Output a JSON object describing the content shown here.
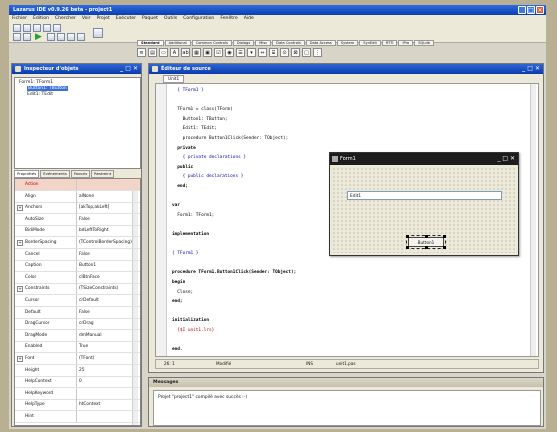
{
  "window": {
    "title": "Lazarus IDE v0.9.26 beta - project1"
  },
  "menu": [
    "Fichier",
    "Édition",
    "Chercher",
    "Voir",
    "Projet",
    "Exécuter",
    "Paquet",
    "Outils",
    "Configuration",
    "Fenêtre",
    "Aide"
  ],
  "palette_tabs": [
    "Standard",
    "Additional",
    "Common Controls",
    "Dialogs",
    "Misc",
    "Data Controls",
    "Data Access",
    "System",
    "SynEdit",
    "RTTI",
    "IPro",
    "SQLdb"
  ],
  "inspector": {
    "title": "Inspecteur d'objets",
    "tree": [
      "Form1: TForm1",
      "Button1: TButton",
      "Edit1: TEdit"
    ],
    "tabs": [
      "Propriétés",
      "Événements",
      "Favoris",
      "Restreint"
    ],
    "properties": [
      {
        "name": "Action",
        "value": "",
        "highlight": true
      },
      {
        "name": "Align",
        "value": "alNone"
      },
      {
        "name": "Anchors",
        "value": "[akTop,akLeft]",
        "expand": true
      },
      {
        "name": "AutoSize",
        "value": "False"
      },
      {
        "name": "BidiMode",
        "value": "bdLeftToRight"
      },
      {
        "name": "BorderSpacing",
        "value": "(TControlBorderSpacing)",
        "expand": true
      },
      {
        "name": "Cancel",
        "value": "False"
      },
      {
        "name": "Caption",
        "value": "Button1"
      },
      {
        "name": "Color",
        "value": "clBtnFace"
      },
      {
        "name": "Constraints",
        "value": "(TSizeConstraints)",
        "expand": true
      },
      {
        "name": "Cursor",
        "value": "crDefault"
      },
      {
        "name": "Default",
        "value": "False"
      },
      {
        "name": "DragCursor",
        "value": "crDrag"
      },
      {
        "name": "DragMode",
        "value": "dmManual"
      },
      {
        "name": "Enabled",
        "value": "True"
      },
      {
        "name": "Font",
        "value": "(TFont)",
        "expand": true
      },
      {
        "name": "Height",
        "value": "25"
      },
      {
        "name": "HelpContext",
        "value": "0"
      },
      {
        "name": "HelpKeyword",
        "value": ""
      },
      {
        "name": "HelpType",
        "value": "htContext"
      },
      {
        "name": "Hint",
        "value": ""
      }
    ]
  },
  "editor": {
    "title": "Éditeur de source",
    "tab": "Unit1",
    "lines": [
      {
        "t": "  { TForm1 }",
        "c": "cm"
      },
      {
        "t": "",
        "c": ""
      },
      {
        "t": "  TForm1 = class(TForm)",
        "c": ""
      },
      {
        "t": "    Button1: TButton;",
        "c": ""
      },
      {
        "t": "    Edit1: TEdit;",
        "c": ""
      },
      {
        "t": "    procedure Button1Click(Sender: TObject);",
        "c": ""
      },
      {
        "t": "  private",
        "c": "kw"
      },
      {
        "t": "    { private declarations }",
        "c": "cm"
      },
      {
        "t": "  public",
        "c": "kw"
      },
      {
        "t": "    { public declarations }",
        "c": "cm"
      },
      {
        "t": "  end;",
        "c": "kw"
      },
      {
        "t": "",
        "c": ""
      },
      {
        "t": "var",
        "c": "kw"
      },
      {
        "t": "  Form1: TForm1;",
        "c": ""
      },
      {
        "t": "",
        "c": ""
      },
      {
        "t": "implementation",
        "c": "kw"
      },
      {
        "t": "",
        "c": ""
      },
      {
        "t": "{ TForm1 }",
        "c": "cm"
      },
      {
        "t": "",
        "c": ""
      },
      {
        "t": "procedure TForm1.Button1Click(Sender: TObject);",
        "c": "kw"
      },
      {
        "t": "begin",
        "c": "kw"
      },
      {
        "t": "  Close;",
        "c": ""
      },
      {
        "t": "end;",
        "c": "kw"
      },
      {
        "t": "",
        "c": ""
      },
      {
        "t": "initialization",
        "c": "kw"
      },
      {
        "t": "  {$I unit1.lrs}",
        "c": "st"
      },
      {
        "t": "",
        "c": ""
      },
      {
        "t": "end.",
        "c": "kw"
      }
    ],
    "status": {
      "pos": "26:  1",
      "mode": "Modifié",
      "ins": "INS",
      "file": "unit1.pas"
    }
  },
  "form_designer": {
    "title": "Form1",
    "edit_text": "Edit1",
    "button_text": "Button1"
  },
  "messages": {
    "title": "Messages",
    "line": "Projet \"project1\" compilé avec succès :-)"
  }
}
